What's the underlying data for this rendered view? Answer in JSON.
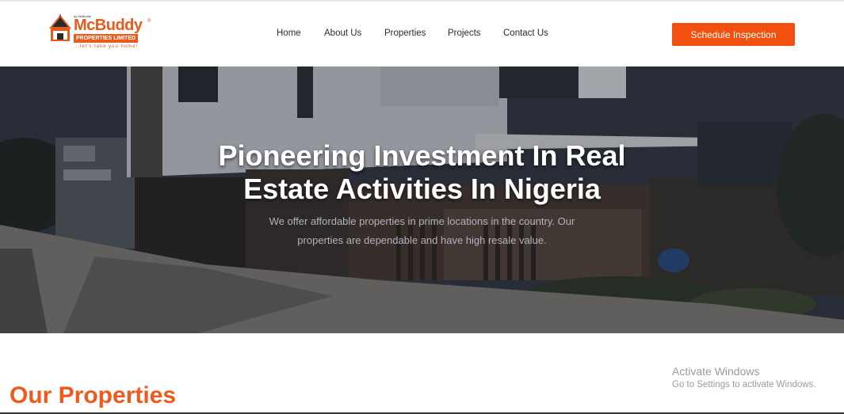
{
  "logo": {
    "brand": "McBuddy",
    "small_mark": "by McBuddy",
    "subtitle": "PROPERTIES LIMITED",
    "tagline": "...let's take you home!",
    "reg_mark": "®"
  },
  "nav": {
    "items": [
      "Home",
      "About Us",
      "Properties",
      "Projects",
      "Contact Us"
    ]
  },
  "cta": {
    "label": "Schedule Inspection"
  },
  "hero": {
    "title_line1": "Pioneering Investment In Real",
    "title_line2": "Estate Activities In Nigeria",
    "text_line1": "We offer affordable properties in prime locations in the country. Our",
    "text_line2": "properties are dependable and have high resale value."
  },
  "section": {
    "title": "Our Properties"
  },
  "watermark": {
    "line1": "Activate Windows",
    "line2": "Go to Settings to activate Windows."
  },
  "colors": {
    "accent": "#f2500f",
    "title_orange": "#ee5a1d"
  }
}
